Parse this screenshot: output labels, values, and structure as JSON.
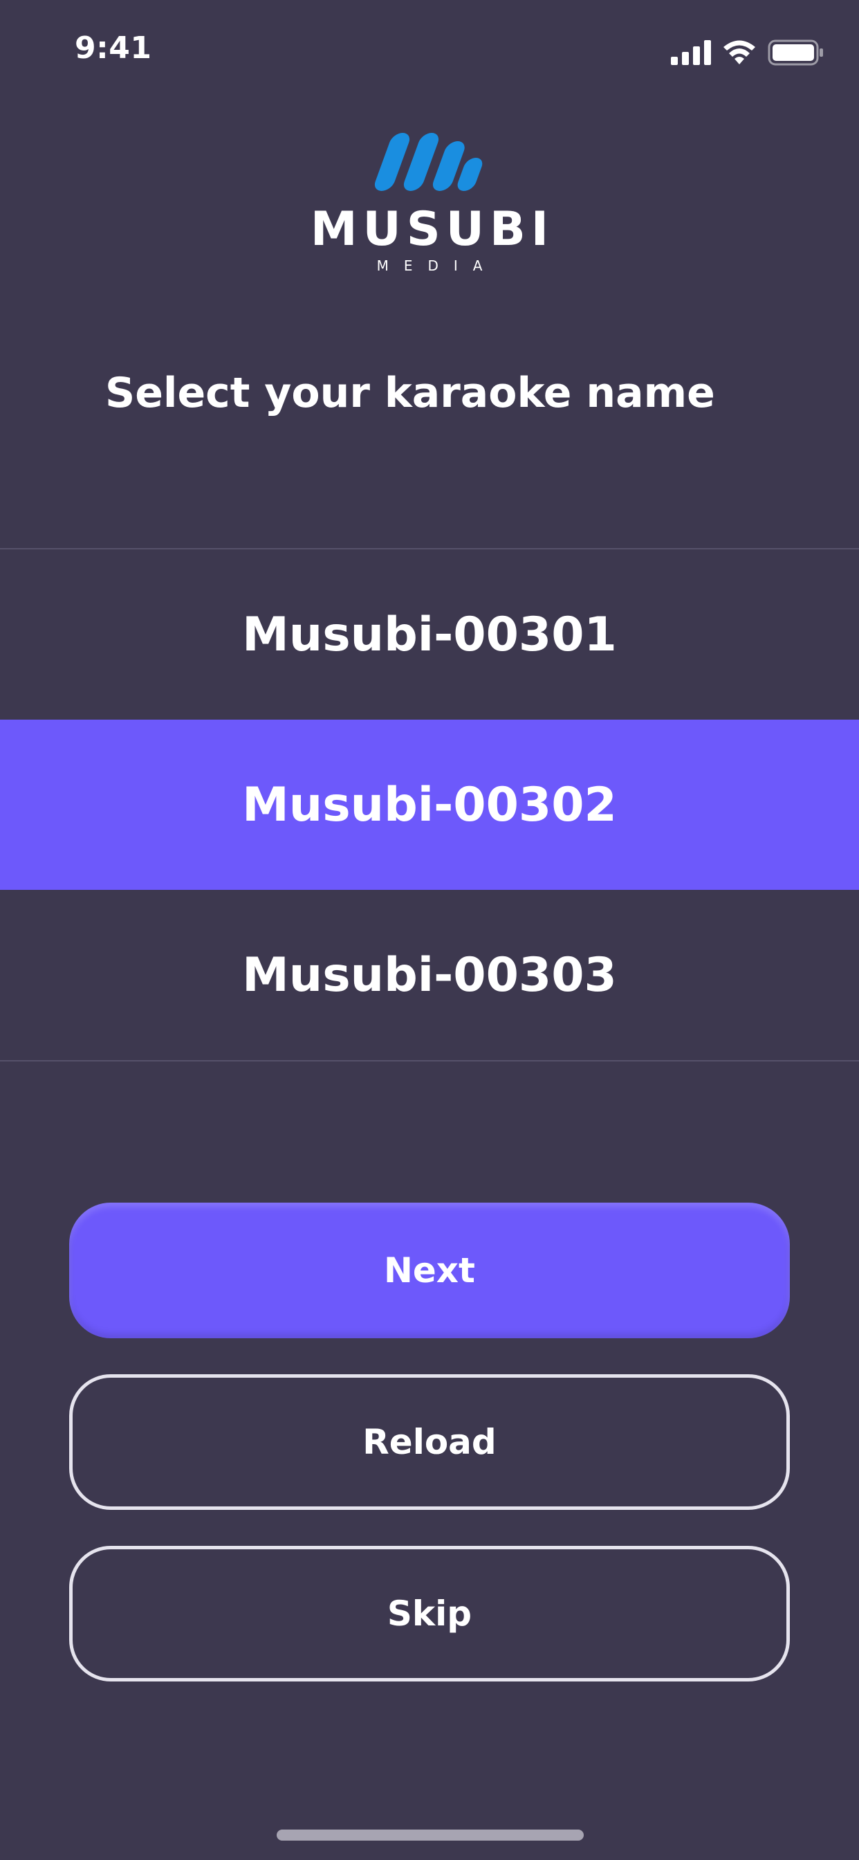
{
  "status_bar": {
    "time": "9:41",
    "icons": [
      "cellular-signal-icon",
      "wifi-icon",
      "battery-icon"
    ]
  },
  "logo": {
    "wordmark": "MUSUBI",
    "subtitle": "MEDIA",
    "mark_color": "#1a8ee0"
  },
  "heading": "Select your karaoke name",
  "names": [
    {
      "label": "Musubi-00301",
      "selected": false
    },
    {
      "label": "Musubi-00302",
      "selected": true
    },
    {
      "label": "Musubi-00303",
      "selected": false
    }
  ],
  "buttons": {
    "next": "Next",
    "reload": "Reload",
    "skip": "Skip"
  },
  "colors": {
    "background": "#3d384f",
    "accent": "#6d59fb",
    "outline": "#e6e4ee"
  }
}
